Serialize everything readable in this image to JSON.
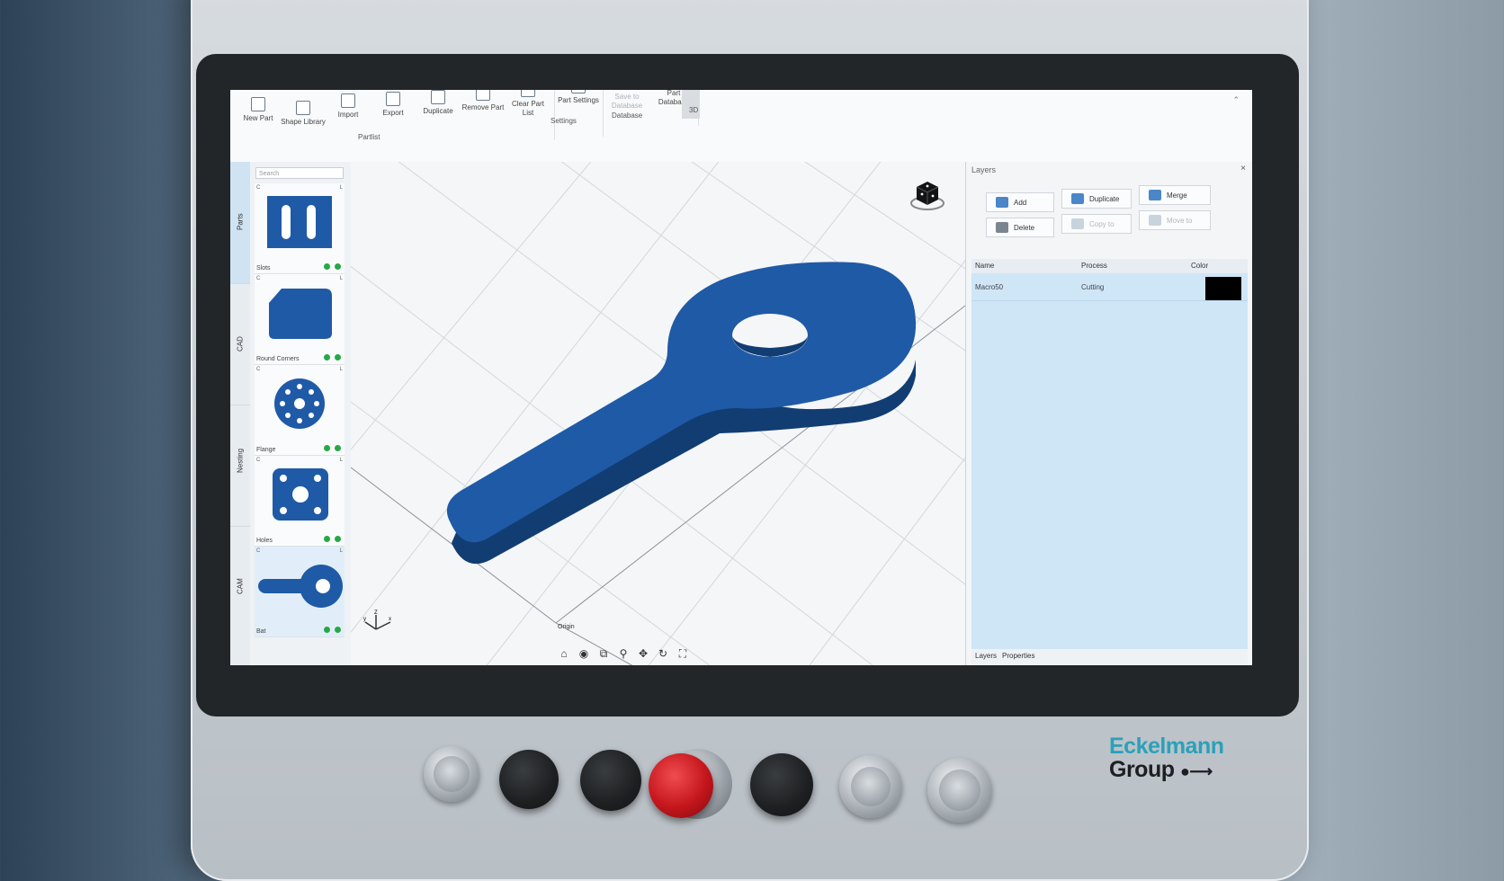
{
  "ribbon": {
    "buttons": [
      {
        "label": "New Part",
        "icon": "new-part-icon"
      },
      {
        "label": "Shape Library",
        "icon": "shape-library-icon"
      },
      {
        "label": "Import",
        "icon": "import-icon"
      },
      {
        "label": "Export",
        "icon": "export-icon"
      },
      {
        "label": "Duplicate",
        "icon": "duplicate-icon"
      },
      {
        "label": "Remove Part",
        "icon": "remove-part-icon"
      },
      {
        "label": "Clear Part List",
        "icon": "clear-part-list-icon"
      },
      {
        "label": "Part Settings",
        "icon": "part-settings-icon"
      },
      {
        "label": "Save to Database",
        "icon": "save-database-icon"
      },
      {
        "label": "Part Database",
        "icon": "part-database-icon"
      },
      {
        "label": "3D",
        "icon": "3d-view-icon"
      }
    ],
    "groups": [
      "Partlist",
      "Settings",
      "Database",
      "3D"
    ]
  },
  "side_tabs": [
    "Parts",
    "CAD",
    "Nesting",
    "CAM"
  ],
  "parts": {
    "search_placeholder": "Search",
    "items": [
      {
        "name": "Slots",
        "c": "C",
        "l": "L"
      },
      {
        "name": "Round Corners",
        "c": "C",
        "l": "L"
      },
      {
        "name": "Flange",
        "c": "C",
        "l": "L"
      },
      {
        "name": "Holes",
        "c": "C",
        "l": "L"
      },
      {
        "name": "Bat",
        "c": "C",
        "l": "L"
      }
    ]
  },
  "viewport": {
    "origin_label": "Origin",
    "axis_labels": {
      "z": "Z",
      "y": "y",
      "x": "x"
    },
    "tools": [
      "home-icon",
      "view-icon",
      "zoom-window-icon",
      "zoom-icon",
      "pan-icon",
      "rotate-icon",
      "fit-icon"
    ],
    "part_color": "#1f5aa6"
  },
  "layers": {
    "title": "Layers",
    "close": "×",
    "buttons": {
      "add": "Add",
      "duplicate": "Duplicate",
      "merge": "Merge",
      "delete": "Delete",
      "copy_to": "Copy to",
      "move_to": "Move to"
    },
    "columns": {
      "name": "Name",
      "process": "Process",
      "color": "Color"
    },
    "rows": [
      {
        "name": "Macro50",
        "process": "Cutting",
        "color": "#000000"
      }
    ],
    "tabs": [
      "Layers",
      "Properties"
    ]
  },
  "brand": {
    "line1": "Eckelmann",
    "line2": "Group"
  },
  "colors": {
    "accent_teal": "#2aa1b9",
    "status_green": "#27a845",
    "estop_red": "#c4161c"
  }
}
